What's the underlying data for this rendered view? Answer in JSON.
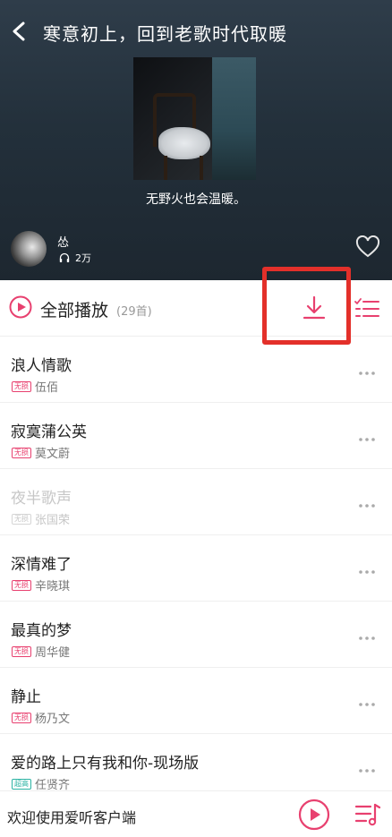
{
  "header": {
    "title": "寒意初上，回到老歌时代取暖",
    "subtitle": "无野火也会温暖。",
    "creator_name": "怂",
    "play_count": "2万"
  },
  "action_bar": {
    "play_all_label": "全部播放",
    "song_count": "(29首)"
  },
  "songs": [
    {
      "title": "浪人情歌",
      "badge": "无损",
      "artist": "伍佰"
    },
    {
      "title": "寂寞蒲公英",
      "badge": "无损",
      "artist": "莫文蔚"
    },
    {
      "title": "夜半歌声",
      "badge": "无损",
      "artist": "张国荣"
    },
    {
      "title": "深情难了",
      "badge": "无损",
      "artist": "辛晓琪"
    },
    {
      "title": "最真的梦",
      "badge": "无损",
      "artist": "周华健"
    },
    {
      "title": "静止",
      "badge": "无损",
      "artist": "杨乃文"
    },
    {
      "title": "爱的路上只有我和你-现场版",
      "badge": "超高",
      "artist": "任贤齐"
    }
  ],
  "bottom_bar": {
    "welcome_text": "欢迎使用爱听客户端"
  },
  "colors": {
    "accent": "#e8406f",
    "highlight_box": "#e3302a",
    "hq_badge": "#2bb3a3"
  },
  "icons": [
    "back-arrow-icon",
    "headphones-icon",
    "heart-icon",
    "play-circle-icon",
    "download-icon",
    "multiselect-list-icon",
    "more-icon",
    "playlist-queue-icon"
  ]
}
